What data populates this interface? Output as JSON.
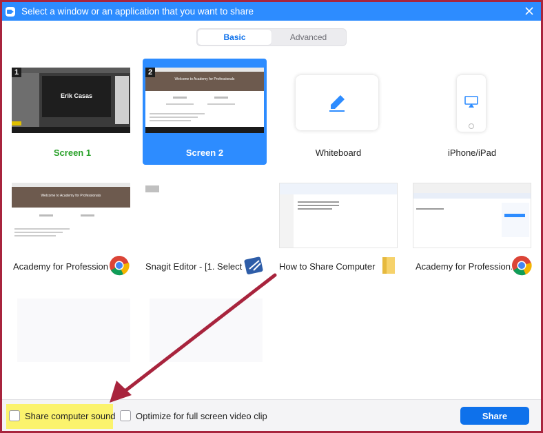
{
  "window": {
    "title": "Select a window or an application that you want to share",
    "accent": "#2d8cff",
    "border_color": "#a8243d"
  },
  "tabs": [
    {
      "label": "Basic",
      "active": true
    },
    {
      "label": "Advanced",
      "active": false
    }
  ],
  "screens": {
    "screen1": {
      "label": "Screen 1",
      "badge": "1",
      "thumb_name_text": "Erik Casas",
      "label_color": "#2aa12a"
    },
    "screen2": {
      "label": "Screen 2",
      "badge": "2",
      "selected": true,
      "thumb_heading": "Welcome to Academy for Professionals"
    },
    "whiteboard": {
      "label": "Whiteboard",
      "icon": "pen-icon"
    },
    "iphone": {
      "label": "iPhone/iPad",
      "icon": "airplay-icon"
    }
  },
  "windows": [
    {
      "label": "Academy for Profession...",
      "app_icon": "chrome-icon",
      "thumb_heading": "Welcome to Academy for Professionals"
    },
    {
      "label": "Snagit Editor - [1. Select ...",
      "app_icon": "snagit-icon"
    },
    {
      "label": "How to Share Computer ...",
      "app_icon": "folder-icon"
    },
    {
      "label": "Academy for Profession...",
      "app_icon": "chrome-icon"
    }
  ],
  "bottom_bar": {
    "share_sound_label": "Share computer sound",
    "share_sound_checked": false,
    "optimize_label": "Optimize for full screen video clip",
    "optimize_checked": false,
    "share_button_label": "Share",
    "highlight_color": "#fbf36d"
  },
  "annotation": {
    "arrow_color": "#a8243d"
  }
}
